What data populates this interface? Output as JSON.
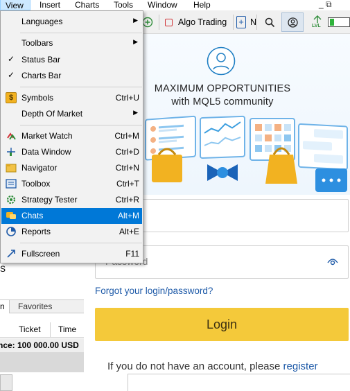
{
  "menubar": {
    "items": [
      "View",
      "Insert",
      "Charts",
      "Tools",
      "Window",
      "Help"
    ],
    "active_index": 0,
    "window_controls": "_ ⧉"
  },
  "toolbar": {
    "algo_trading_label": "Algo Trading",
    "new_order_partial": "N",
    "level_label": "LVL"
  },
  "view_menu": {
    "items": [
      {
        "label": "Languages",
        "shortcut": "",
        "submenu": true,
        "checked": false,
        "icon": ""
      },
      {
        "label": "Toolbars",
        "shortcut": "",
        "submenu": true,
        "checked": false,
        "icon": ""
      },
      {
        "label": "Status Bar",
        "shortcut": "",
        "submenu": false,
        "checked": true,
        "icon": ""
      },
      {
        "label": "Charts Bar",
        "shortcut": "",
        "submenu": false,
        "checked": true,
        "icon": ""
      },
      {
        "label": "Symbols",
        "shortcut": "Ctrl+U",
        "submenu": false,
        "checked": false,
        "icon": "dollar-icon"
      },
      {
        "label": "Depth Of Market",
        "shortcut": "",
        "submenu": true,
        "checked": false,
        "icon": ""
      },
      {
        "label": "Market Watch",
        "shortcut": "Ctrl+M",
        "submenu": false,
        "checked": false,
        "icon": "market-watch-icon"
      },
      {
        "label": "Data Window",
        "shortcut": "Ctrl+D",
        "submenu": false,
        "checked": false,
        "icon": "crosshair-icon"
      },
      {
        "label": "Navigator",
        "shortcut": "Ctrl+N",
        "submenu": false,
        "checked": false,
        "icon": "folder-icon"
      },
      {
        "label": "Toolbox",
        "shortcut": "Ctrl+T",
        "submenu": false,
        "checked": false,
        "icon": "toolbox-icon"
      },
      {
        "label": "Strategy Tester",
        "shortcut": "Ctrl+R",
        "submenu": false,
        "checked": false,
        "icon": "gear-icon"
      },
      {
        "label": "Chats",
        "shortcut": "Alt+M",
        "submenu": false,
        "checked": false,
        "icon": "chat-icon",
        "highlighted": true
      },
      {
        "label": "Reports",
        "shortcut": "Alt+E",
        "submenu": false,
        "checked": false,
        "icon": "reports-icon"
      },
      {
        "label": "Fullscreen",
        "shortcut": "F11",
        "submenu": false,
        "checked": false,
        "icon": "fullscreen-icon"
      }
    ]
  },
  "left_panel": {
    "partial_text": "S",
    "tabs": [
      "n",
      "Favorites"
    ],
    "trade_columns": [
      "Ticket",
      "Time"
    ],
    "balance_text": "nce: 100 000.00 USD"
  },
  "login_dialog": {
    "banner_title_line1": "MAXIMUM OPPORTUNITIES",
    "banner_title_line2": "with MQL5 community",
    "login_value": "",
    "password_placeholder": "Password",
    "forgot_link": "Forgot your login/password?",
    "login_button": "Login",
    "register_prefix": "If you do not have an account, please ",
    "register_link": "register"
  },
  "colors": {
    "menu_highlight": "#0078d7",
    "login_button": "#f4c93a",
    "link": "#1e5aa8",
    "active_menu": "#cce8ff"
  }
}
